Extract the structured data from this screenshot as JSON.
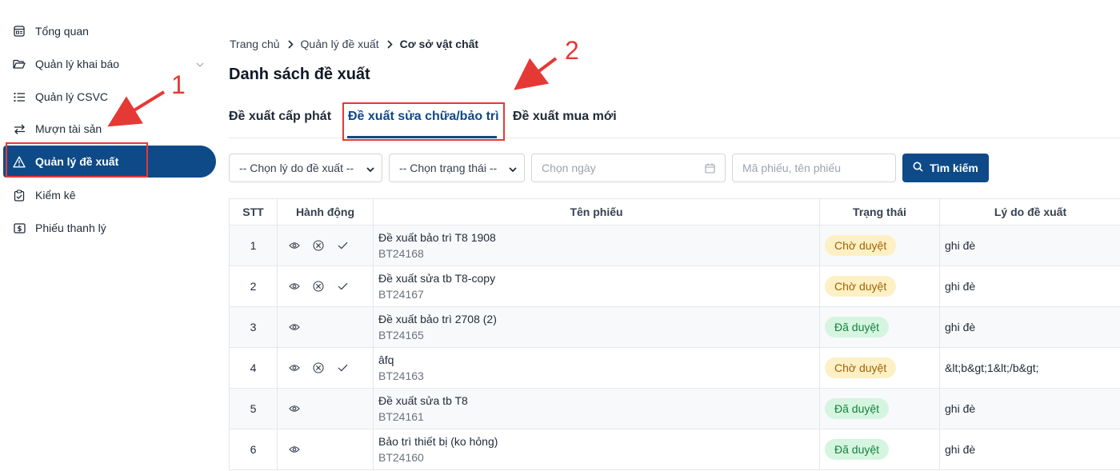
{
  "sidebar": {
    "items": [
      {
        "label": "Tổng quan",
        "icon": "dashboard-icon"
      },
      {
        "label": "Quản lý khai báo",
        "icon": "folder-open-icon"
      },
      {
        "label": "Quản lý CSVC",
        "icon": "list-icon"
      },
      {
        "label": "Mượn tài sản",
        "icon": "swap-arrows-icon"
      },
      {
        "label": "Quản lý đề xuất",
        "icon": "warning-triangle-icon",
        "active": true
      },
      {
        "label": "Kiểm kê",
        "icon": "clipboard-check-icon"
      },
      {
        "label": "Phiếu thanh lý",
        "icon": "receipt-dollar-icon"
      }
    ]
  },
  "breadcrumb": {
    "home": "Trang chủ",
    "parent": "Quản lý đề xuất",
    "current": "Cơ sở vật chất"
  },
  "page": {
    "title": "Danh sách đề xuất"
  },
  "tabs": [
    {
      "label": "Đề xuất cấp phát"
    },
    {
      "label": "Đề xuất sửa chữa/bảo trì",
      "active": true
    },
    {
      "label": "Đề xuất mua mới"
    }
  ],
  "filters": {
    "reason_select": "-- Chọn lý do đề xuất --",
    "status_select": "-- Chọn trạng thái --",
    "date_placeholder": "Chọn ngày",
    "search_placeholder": "Mã phiếu, tên phiếu",
    "search_button": "Tìm kiếm"
  },
  "table": {
    "headers": [
      "STT",
      "Hành động",
      "Tên phiếu",
      "Trạng thái",
      "Lý do đề xuất"
    ],
    "rows": [
      {
        "stt": "1",
        "name": "Đề xuất bảo trì T8 1908",
        "code": "BT24168",
        "status": "Chờ duyệt",
        "status_type": "pending",
        "reason": "ghi đè",
        "actions": [
          "view",
          "reject",
          "approve"
        ]
      },
      {
        "stt": "2",
        "name": "Đề xuất sửa tb T8-copy",
        "code": "BT24167",
        "status": "Chờ duyệt",
        "status_type": "pending",
        "reason": "ghi đè",
        "actions": [
          "view",
          "reject",
          "approve"
        ]
      },
      {
        "stt": "3",
        "name": "Đề xuất bảo trì 2708 (2)",
        "code": "BT24165",
        "status": "Đã duyệt",
        "status_type": "approved",
        "reason": "ghi đè",
        "actions": [
          "view"
        ]
      },
      {
        "stt": "4",
        "name": "âfq",
        "code": "BT24163",
        "status": "Chờ duyệt",
        "status_type": "pending",
        "reason": "&lt;b&gt;1&lt;/b&gt;",
        "actions": [
          "view",
          "reject",
          "approve"
        ]
      },
      {
        "stt": "5",
        "name": "Đề xuất sửa tb T8",
        "code": "BT24161",
        "status": "Đã duyệt",
        "status_type": "approved",
        "reason": "ghi đè",
        "actions": [
          "view"
        ]
      },
      {
        "stt": "6",
        "name": "Bảo trì thiết bị (ko hỏng)",
        "code": "BT24160",
        "status": "Đã duyệt",
        "status_type": "approved",
        "reason": "ghi đè",
        "actions": [
          "view"
        ]
      }
    ]
  },
  "annotations": [
    "1",
    "2"
  ],
  "colors": {
    "primary": "#0d4a87",
    "annotation": "#e53935",
    "pending_bg": "#fdf0c4",
    "approved_bg": "#d5f5e0"
  }
}
